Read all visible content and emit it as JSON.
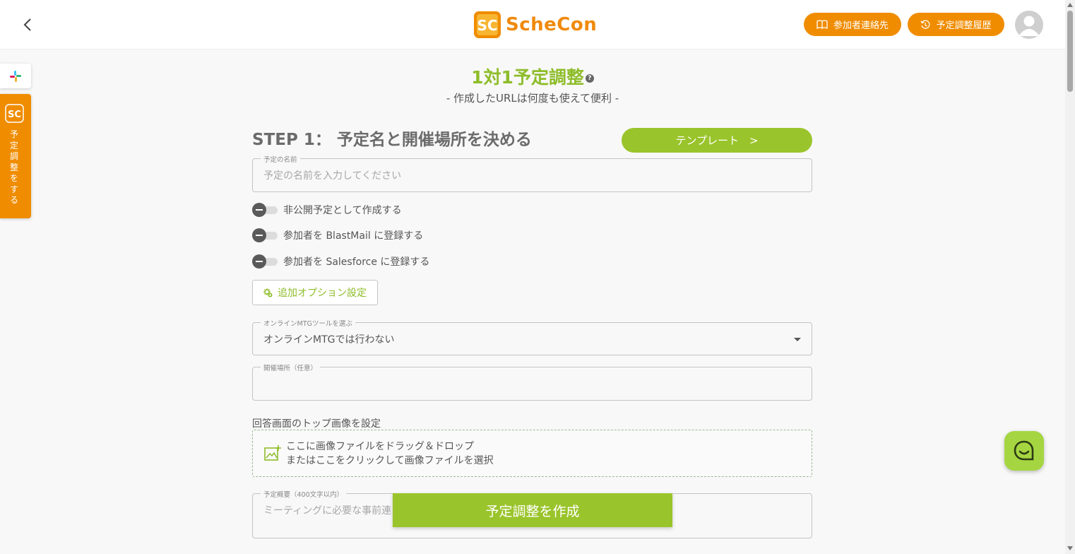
{
  "header": {
    "app_name": "ScheCon",
    "contacts_button": "参加者連絡先",
    "history_button": "予定調整履歴"
  },
  "sidebar": {
    "schedule_tab_label": "予定調整をする"
  },
  "page": {
    "title": "1対1予定調整",
    "subtitle": "- 作成したURLは何度も使えて便利 -",
    "step_heading": "STEP 1： 予定名と開催場所を決める",
    "template_button": "テンプレート　>"
  },
  "form": {
    "event_name": {
      "label": "予定の名前",
      "placeholder": "予定の名前を入力してください"
    },
    "toggles": [
      {
        "label": "非公開予定として作成する",
        "on": false
      },
      {
        "label": "参加者を BlastMail に登録する",
        "on": false
      },
      {
        "label": "参加者を Salesforce に登録する",
        "on": false
      }
    ],
    "options_button": "追加オプション設定",
    "mtg_tool": {
      "label": "オンラインMTGツールを選ぶ",
      "value": "オンラインMTGでは行わない"
    },
    "location": {
      "label": "開催場所（任意）",
      "value": ""
    },
    "top_image": {
      "label": "回答画面のトップ画像を設定",
      "drop_line1": "ここに画像ファイルをドラッグ＆ドロップ",
      "drop_line2": "またはここをクリックして画像ファイルを選択"
    },
    "summary": {
      "label": "予定概要（400文字以内）",
      "placeholder": "ミーティングに必要な事前連"
    },
    "create_button": "予定調整を作成"
  },
  "colors": {
    "accent_orange": "#f08c00",
    "accent_green": "#9ac42b",
    "chat_green": "#a5d641"
  },
  "icons": [
    "back-icon",
    "book-icon",
    "history-icon",
    "avatar-icon",
    "slack-icon",
    "schecon-icon",
    "help-icon",
    "settings-plus-icon",
    "caret-down-icon",
    "image-add-icon",
    "chat-icon"
  ]
}
